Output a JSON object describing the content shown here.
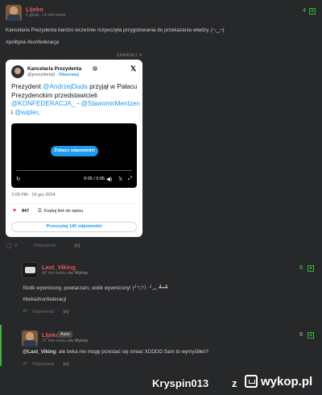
{
  "post": {
    "username": "Lljeko",
    "time": "1 godz. i 9 min temu",
    "votes": "4",
    "text": "Kancelaria Prezydenta bardzo wcześnie rozpoczęła przygotowania do przekazania władzy. (¬‿¬)",
    "tags": "#polityka #konfederacja",
    "close_embed": "ZAMKNIJ ✕",
    "footer_comments": "3",
    "footer_hidden": "Odpowiedz"
  },
  "tweet": {
    "name": "Kancelaria Prezydenta",
    "handle": "@prezydentpl",
    "follow": "Obserwuj",
    "text_plain_1": "Prezydent ",
    "mention_1": "@AndrzejDuda",
    "text_plain_2": " przyjął w Pałacu Prezydenckim przedstawicieli ",
    "mention_2": "@KONFEDERACJA_",
    "text_plain_3": " - ",
    "mention_3": "@SlawomirMentzen",
    "text_plain_4": " i ",
    "mention_4": "@wipler",
    "text_plain_5": ".",
    "video_button": "Zobacz odpowiedzi",
    "video_time": "0:05 / 0:05",
    "date": "2:09 PM · 19 gru 2024",
    "likes": "847",
    "copy_link": "Kopiuj link do wpisu",
    "read_replies": "Przeczytaj 140 odpowiedzi"
  },
  "comments": [
    {
      "username": "Last_Viking",
      "time": "42 min temu",
      "via": "via Wykop",
      "votes": "5",
      "text": "Stolik wywrócony, powtarzam, stolik wywrócony! (╯°□°）╯︵ ┻━┻",
      "tag": "#bekazkonfederacji",
      "footer": "Odpowiedz"
    },
    {
      "username": "Lljeko",
      "badge": "Autor",
      "time": "27 min temu",
      "via": "via Wykop",
      "votes": "0",
      "mention": "@Last_Viking",
      "text": ": ale beka nie mogę przestać się śmiać XDDDD Sam to wymyśliłeś?",
      "footer": "Odpowiedz"
    }
  ],
  "watermark": {
    "user": "Kryspin013",
    "z": "z",
    "site": "wykop.pl"
  },
  "colors": {
    "background": "#27282a",
    "username": "#e05757",
    "vote": "#3bb33b",
    "link": "#1d9bf0"
  }
}
